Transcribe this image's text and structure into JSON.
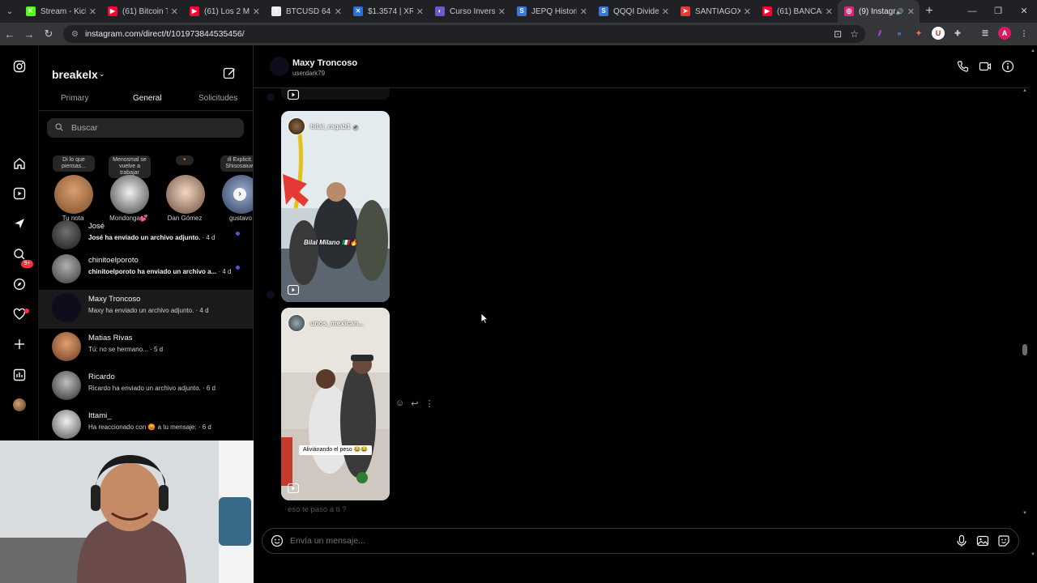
{
  "browser": {
    "tabs": [
      {
        "label": "Stream - Kick D",
        "icon": "kick-icon",
        "color": "#53fc18"
      },
      {
        "label": "(61) Bitcoin Tra",
        "icon": "youtube-icon",
        "color": "#ff0033"
      },
      {
        "label": "(61) Los 2 MEJ",
        "icon": "youtube-icon",
        "color": "#ff0033"
      },
      {
        "label": "BTCUSD 64.819",
        "icon": "tradingview-icon",
        "color": "#e8eaed"
      },
      {
        "label": "$1.3574 | XRP",
        "icon": "x-icon",
        "color": "#2a6fdb"
      },
      {
        "label": "Curso Inversió",
        "icon": "globe-icon",
        "color": "#6a5acd"
      },
      {
        "label": "JEPQ Historical",
        "icon": "sa-icon",
        "color": "#3a78d8"
      },
      {
        "label": "QQQI Dividend",
        "icon": "sa-icon",
        "color": "#3a78d8"
      },
      {
        "label": "SANTIAGOX",
        "icon": "arrow-icon",
        "color": "#e53935"
      },
      {
        "label": "(61) BANCAL D",
        "icon": "youtube-icon",
        "color": "#ff0033"
      },
      {
        "label": "(9) Instagram",
        "icon": "instagram-icon",
        "color": "#d62976",
        "active": true
      }
    ],
    "url": "instagram.com/direct/t/101973844535456/"
  },
  "inbox": {
    "account": "breakelx",
    "tabs": [
      "Primary",
      "General",
      "Solicitudes"
    ],
    "selected_tab": "General",
    "search_placeholder": "Buscar",
    "notes": [
      {
        "bubble": "Di lo que piensas...",
        "name": "Tu nota",
        "color": "#b07a4a"
      },
      {
        "bubble": "Menosmal se vuelve a trabajar",
        "name": "Mondonga💕",
        "color": "#8a8a8a"
      },
      {
        "bubble": "🔸",
        "name": "Dan Gómez",
        "color": "#c9a48a"
      },
      {
        "bubble": "ıll Explicit... Shisosaiuwo",
        "name": "gustavo",
        "color": "#4a5a7a"
      }
    ],
    "threads": [
      {
        "name": "José",
        "msg": "José ha enviado un archivo adjunto.",
        "time": " · 4 d",
        "unread": true,
        "color": "#3a3a3a"
      },
      {
        "name": "chinitoelporoto",
        "msg": "chinitoelporoto ha enviado un archivo a...",
        "time": " · 4 d",
        "unread": true,
        "color": "#6e6e6e"
      },
      {
        "name": "Maxy Troncoso",
        "msg": "Maxy ha enviado un archivo adjunto.",
        "time": " · 4 d",
        "unread": false,
        "color": "#0f0c1c",
        "selected": true
      },
      {
        "name": "Matias Rivas",
        "msg": "Tú: no se hermano...",
        "time": " · 5 d",
        "unread": false,
        "color": "#9a6a4a"
      },
      {
        "name": "Ricardo",
        "msg": "Ricardo ha enviado un archivo adjunto.",
        "time": " · 6 d",
        "unread": false,
        "color": "#777"
      },
      {
        "name": "Ittami_",
        "msg": "Ha reaccionado con 😡 a tu mensaje:",
        "time": " · 6 d",
        "unread": false,
        "color": "#cfcfcf"
      }
    ]
  },
  "rail": {
    "icons": [
      "instagram-icon",
      "home-icon",
      "reels-icon",
      "messages-icon",
      "search-icon",
      "explore-icon",
      "notifications-icon",
      "create-icon",
      "dashboard-icon",
      "profile-icon"
    ],
    "badge": "9+"
  },
  "chat": {
    "name": "Maxy Troncoso",
    "username": "userdark79",
    "reels": [
      {
        "user": "bilal_ragab1",
        "verified": true,
        "overlay": "Bilal Milano 🇮🇹🔥",
        "caption": ""
      },
      {
        "user": "unos_mexican...",
        "verified": false,
        "overlay": "",
        "caption": "Aliviánando el peso 😂😂"
      }
    ],
    "faded_message": "eso te pasó a ti ?",
    "composer_placeholder": "Envía un mensaje..."
  }
}
